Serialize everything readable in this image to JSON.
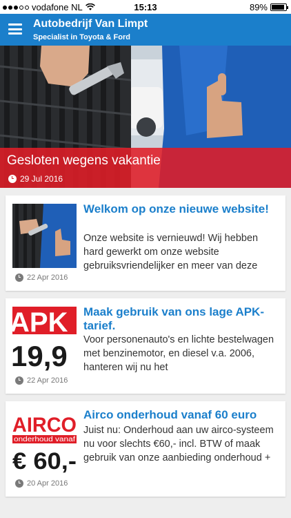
{
  "status_bar": {
    "carrier": "vodafone NL",
    "time": "15:13",
    "battery": "89%",
    "battery_level": 0.89,
    "signal_icon": "signal-dots-icon",
    "wifi_icon": "wifi-icon",
    "battery_icon": "battery-icon"
  },
  "header": {
    "title": "Autobedrijf Van Limpt",
    "subtitle": "Specialist in Toyota & Ford",
    "menu_icon": "hamburger-menu-icon",
    "color": "#1b7fcb"
  },
  "featured": {
    "title": "Gesloten wegens vakantie",
    "date": "29 Jul 2016",
    "overlay_color": "#e01e28"
  },
  "articles": [
    {
      "title": "Welkom op onze nieuwe website!",
      "excerpt": "Onze website is vernieuwd! Wij hebben hard gewerkt om onze website gebruiksvriendelijker en meer van deze",
      "date": "22 Apr 2016"
    },
    {
      "title": "Maak gebruik van ons lage APK-tarief.",
      "excerpt": "Voor personenauto's en lichte bestelwagen met benzinemotor, en diesel v.a. 2006, hanteren wij nu het",
      "date": "22 Apr 2016",
      "thumb_text_top": "APK",
      "thumb_text_price": "19,9"
    },
    {
      "title": "Airco onderhoud vanaf 60 euro",
      "excerpt": "Juist nu: Onderhoud aan uw airco-systeem nu voor slechts €60,- incl. BTW of maak gebruik van onze aanbieding onderhoud +",
      "date": "20 Apr 2016",
      "thumb_text_top": "AIRCO",
      "thumb_text_mid": "onderhoud vanaf",
      "thumb_text_price": "€ 60,-"
    }
  ]
}
